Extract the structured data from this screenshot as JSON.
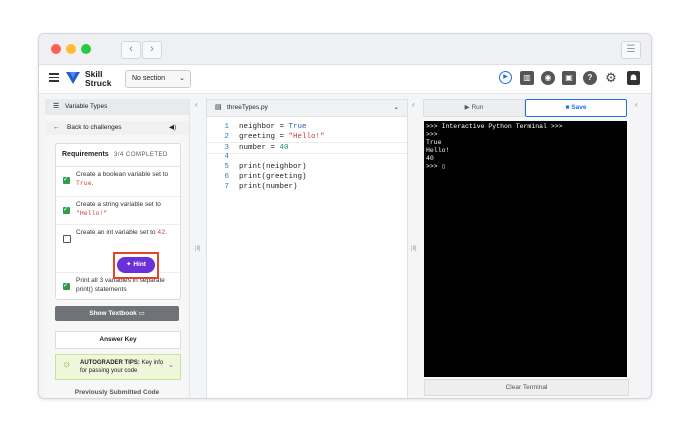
{
  "colors": {
    "accent": "#1f6feb",
    "hint": "#6a31d8",
    "highlight": "#e2452a",
    "check": "#2e9c4a"
  },
  "icons": [
    "menu-icon",
    "skillstruck-logo",
    "chevron-down-icon",
    "run-icon",
    "textbook-icon",
    "palette-icon",
    "image-icon",
    "help-icon",
    "gear-icon",
    "avatar-icon",
    "list-icon",
    "back-arrow-icon",
    "speaker-icon",
    "file-icon",
    "play-icon",
    "save-icon",
    "sparkle-icon",
    "lightbulb-icon"
  ],
  "titlebar": {
    "back": "‹",
    "forward": "›",
    "sidebar": "☰"
  },
  "appbar": {
    "logo_line1": "Skill",
    "logo_line2": "Struck",
    "section": "No section"
  },
  "left": {
    "title": "Variable Types",
    "back": "Back to challenges",
    "req_title": "Requirements",
    "req_status": "3/4 COMPLETED",
    "items": [
      {
        "text": "Create a boolean variable set to ",
        "code": "True",
        "tail": "."
      },
      {
        "text": "Create a string variable set to ",
        "code": "\"Hello!\"",
        "tail": ""
      },
      {
        "text": "Create an int variable set to ",
        "code": "42",
        "tail": "."
      },
      {
        "text": "Print all 3 variables in separate print() statements",
        "code": "",
        "tail": ""
      }
    ],
    "hint": "Hint",
    "show_textbook": "Show Textbook",
    "answer_key": "Answer Key",
    "tips_bold": "AUTOGRADER TIPS:",
    "tips_text": " Key info for passing your code",
    "prev": "Previously Submitted Code"
  },
  "editor": {
    "filename": "threeTypes.py",
    "lines": [
      {
        "n": "1",
        "a": "neighbor = ",
        "b": "True",
        "cls": "kw-true"
      },
      {
        "n": "2",
        "a": "greeting = ",
        "b": "\"Hello!\"",
        "cls": "str"
      },
      {
        "n": "3",
        "a": "number = ",
        "b": "40",
        "cls": "num"
      },
      {
        "n": "4",
        "a": "",
        "b": "",
        "cls": ""
      },
      {
        "n": "5",
        "a": "print(neighbor)",
        "b": "",
        "cls": ""
      },
      {
        "n": "6",
        "a": "print(greeting)",
        "b": "",
        "cls": ""
      },
      {
        "n": "7",
        "a": "print(number)",
        "b": "",
        "cls": ""
      }
    ]
  },
  "run": {
    "run": "Run",
    "save": "Save",
    "terminal": [
      ">>> Interactive Python Terminal >>>",
      ">>>",
      "True",
      "Hello!",
      "40",
      ">>> ▯"
    ],
    "clear": "Clear Terminal"
  }
}
